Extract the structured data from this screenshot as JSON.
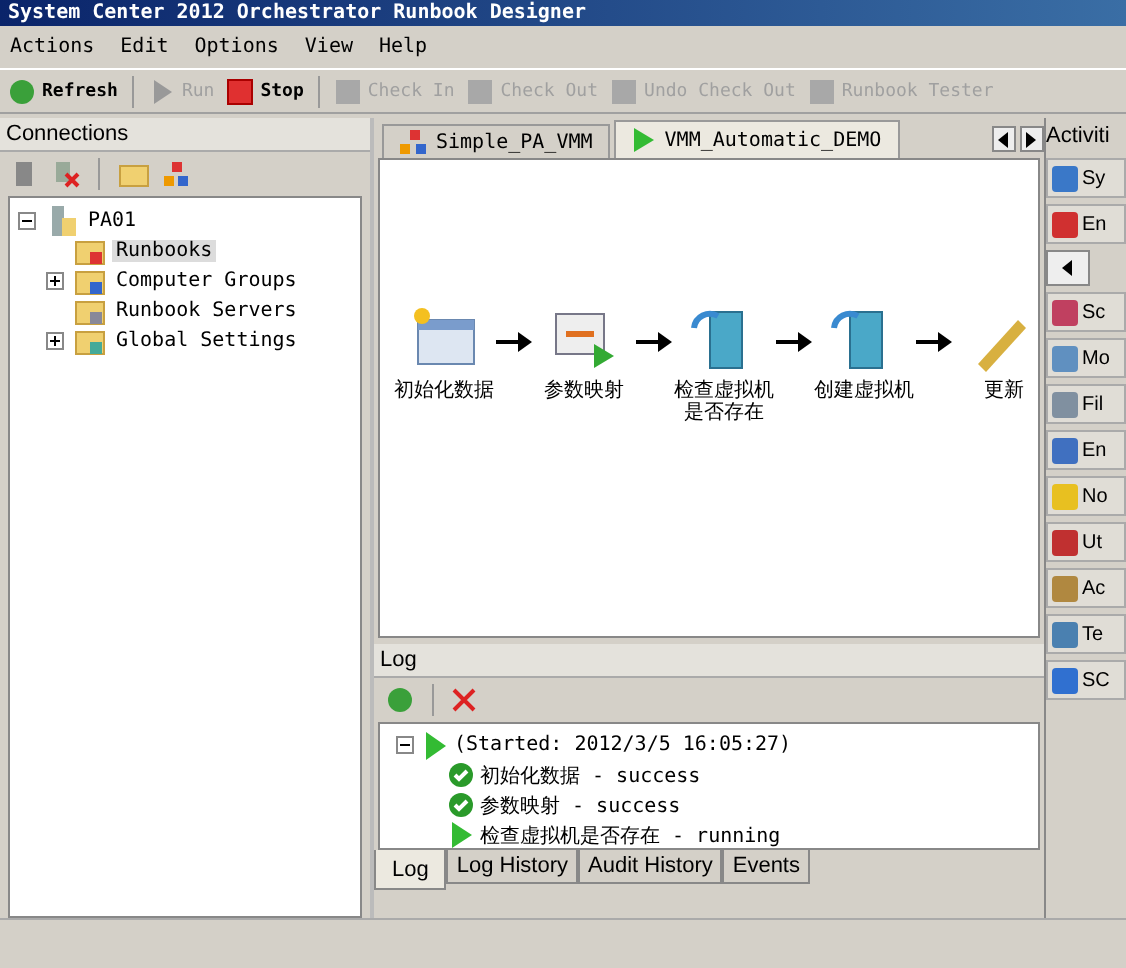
{
  "window": {
    "title": "System Center 2012 Orchestrator Runbook Designer"
  },
  "menu": [
    "Actions",
    "Edit",
    "Options",
    "View",
    "Help"
  ],
  "toolbar": [
    {
      "label": "Refresh",
      "kind": "refresh",
      "disabled": false
    },
    {
      "label": "Run",
      "kind": "run",
      "disabled": true
    },
    {
      "label": "Stop",
      "kind": "stop",
      "disabled": false
    },
    {
      "label": "Check In",
      "kind": "checkin",
      "disabled": true
    },
    {
      "label": "Check Out",
      "kind": "checkout",
      "disabled": true
    },
    {
      "label": "Undo Check Out",
      "kind": "undo",
      "disabled": true
    },
    {
      "label": "Runbook Tester",
      "kind": "tester",
      "disabled": true
    }
  ],
  "connections": {
    "title": "Connections",
    "tree": [
      {
        "label": "PA01",
        "expanded": true,
        "selected": false,
        "children": [
          {
            "label": "Runbooks",
            "selected": true
          },
          {
            "label": "Computer Groups",
            "expanded": false,
            "selected": false
          },
          {
            "label": "Runbook Servers",
            "selected": false
          },
          {
            "label": "Global Settings",
            "expanded": false,
            "selected": false
          }
        ]
      }
    ]
  },
  "tabs": [
    {
      "label": "Simple_PA_VMM",
      "kind": "folder",
      "selected": false
    },
    {
      "label": "VMM_Automatic_DEMO",
      "kind": "running",
      "selected": true
    }
  ],
  "workflow": [
    {
      "label": "初始化数据",
      "kind": "table"
    },
    {
      "label": "参数映射",
      "kind": "map"
    },
    {
      "label": "检查虚拟机是否存在",
      "kind": "server"
    },
    {
      "label": "创建虚拟机",
      "kind": "server"
    },
    {
      "label": "更新",
      "kind": "pen"
    }
  ],
  "log": {
    "title": "Log",
    "entry": {
      "label": "(Started: 2012/3/5 16:05:27)",
      "expanded": true,
      "children": [
        {
          "label": "初始化数据 - success",
          "kind": "success"
        },
        {
          "label": "参数映射 - success",
          "kind": "success"
        },
        {
          "label": "检查虚拟机是否存在 - running",
          "kind": "running"
        }
      ]
    },
    "tabs": [
      {
        "label": "Log",
        "selected": true
      },
      {
        "label": "Log History",
        "selected": false
      },
      {
        "label": "Audit History",
        "selected": false
      },
      {
        "label": "Events",
        "selected": false
      }
    ]
  },
  "activities": {
    "title": "Activiti",
    "items": [
      {
        "label": "Sy",
        "color": "#3a78c8"
      },
      {
        "label": "En",
        "color": "#d03030"
      },
      {
        "label": "Sc",
        "color": "#c04060"
      },
      {
        "label": "Mo",
        "color": "#6090c0"
      },
      {
        "label": "Fil",
        "color": "#8090a0"
      },
      {
        "label": "En",
        "color": "#4070c0"
      },
      {
        "label": "No",
        "color": "#e8c020"
      },
      {
        "label": "Ut",
        "color": "#c03030"
      },
      {
        "label": "Ac",
        "color": "#b08840"
      },
      {
        "label": "Te",
        "color": "#4a80b0"
      },
      {
        "label": "SC",
        "color": "#3070d0"
      }
    ]
  }
}
